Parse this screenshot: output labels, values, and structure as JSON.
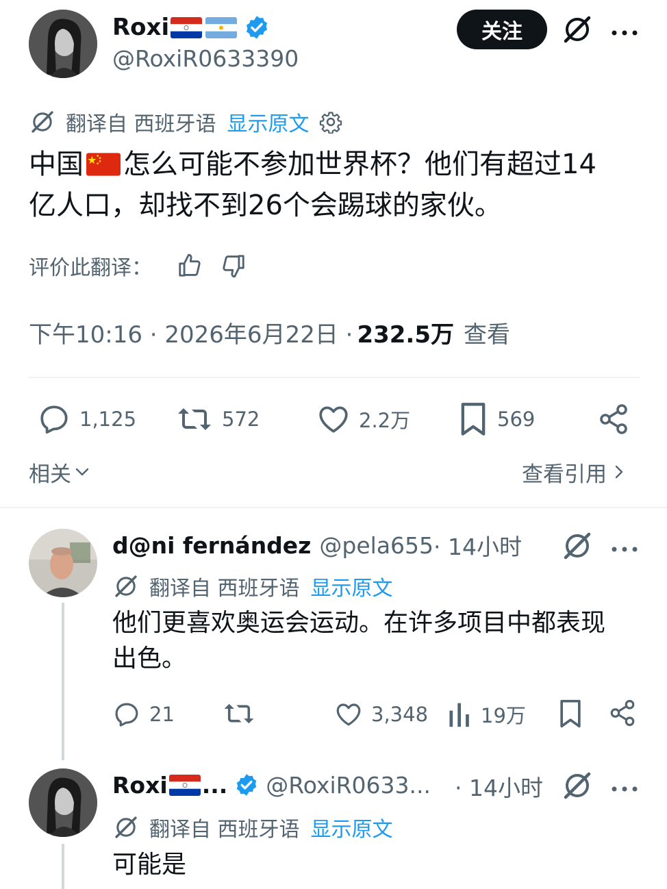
{
  "main_tweet": {
    "author_name": "Roxi",
    "handle": "@RoxiR0633390",
    "follow_label": "关注",
    "translated_from": "翻译自 西班牙语",
    "show_original": "显示原文",
    "text_line1_a": "中国",
    "text_line1_b": "怎么可能不参加世界杯？他们有超过14",
    "text_line2": "亿人口，却找不到26个会踢球的家伙。",
    "rate_translation": "评价此翻译：",
    "timestamp": "下午10:16 · 2026年6月22日 · ",
    "views_count": "232.5万",
    "views_label": "查看",
    "replies": "1,125",
    "retweets": "572",
    "likes": "2.2万",
    "bookmarks": "569",
    "related": "相关",
    "view_quotes": "查看引用"
  },
  "reply1": {
    "author_name": "d@ni fernández",
    "handle": "@pela655",
    "time": " · 14小时",
    "translated_from": "翻译自 西班牙语",
    "show_original": "显示原文",
    "text_line1": "他们更喜欢奥运会运动。在许多项目中都表现",
    "text_line2": "出色。",
    "replies": "21",
    "likes": "3,348",
    "views": "19万"
  },
  "reply2": {
    "author_name": "Roxi",
    "ellipsis": "...",
    "handle": "@RoxiR0633...",
    "time": "· 14小时",
    "translated_from": "翻译自 西班牙语",
    "show_original": "显示原文",
    "text": "可能是"
  },
  "colors": {
    "text": "#0f1419",
    "secondary": "#536471",
    "link": "#1d9bf0",
    "verified": "#1d9bf0",
    "divider": "#eff3f4"
  },
  "icons": [
    "grok-icon",
    "more-icon",
    "verified-badge-icon",
    "translate-icon",
    "gear-icon",
    "thumbs-up-icon",
    "thumbs-down-icon",
    "reply-icon",
    "retweet-icon",
    "like-icon",
    "bookmark-icon",
    "share-icon",
    "views-icon",
    "chevron-down-icon",
    "chevron-right-icon"
  ]
}
